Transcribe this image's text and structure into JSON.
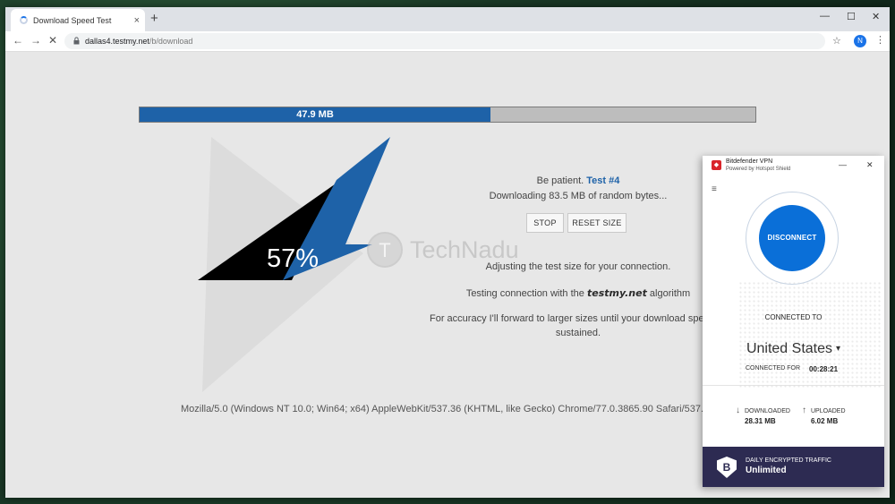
{
  "browser": {
    "tab_title": "Download Speed Test",
    "tab_close": "×",
    "new_tab": "+",
    "window_controls": [
      "—",
      "☐",
      "✕"
    ],
    "nav": {
      "back": "←",
      "forward": "→",
      "reload": "✕"
    },
    "url_host": "dallas4.testmy.net",
    "url_path": "/b/download",
    "profile_initial": "N",
    "menu": "⋮",
    "star": "☆"
  },
  "test": {
    "progress_label": "47.9 MB",
    "progress_fraction": 0.57,
    "percent": "57%",
    "patience_text": "Be patient.",
    "test_number": "Test #4",
    "downloading_text": "Downloading 83.5 MB of random bytes...",
    "stop_label": "STOP",
    "reset_label": "RESET SIZE",
    "adjusting_text": "Adjusting the test size for your connection.",
    "testing_prefix": "Testing connection with the",
    "brand": "testmy.net",
    "testing_suffix": "algorithm",
    "accuracy_line1": "For accuracy I'll forward to larger sizes until your download spe",
    "accuracy_line2": "sustained.",
    "user_agent": "Mozilla/5.0 (Windows NT 10.0; Win64; x64) AppleWebKit/537.36 (KHTML, like Gecko) Chrome/77.0.3865.90 Safari/537."
  },
  "watermark": {
    "glyph": "T",
    "text": "TechNadu"
  },
  "vpn": {
    "title": "Bitdefender VPN",
    "subtitle": "Powered by Hotspot Shield",
    "minimize": "—",
    "close": "✕",
    "menu_icon": "≡",
    "disconnect_label": "DISCONNECT",
    "connected_to_label": "CONNECTED TO",
    "country": "United States",
    "country_caret": "▾",
    "connected_for_label": "CONNECTED FOR",
    "duration": "00:28:21",
    "downloaded_label": "DOWNLOADED",
    "downloaded_value": "28.31 MB",
    "uploaded_label": "UPLOADED",
    "uploaded_value": "6.02 MB",
    "download_arrow": "↓",
    "upload_arrow": "↑",
    "footer_label": "DAILY ENCRYPTED TRAFFIC",
    "footer_value": "Unlimited",
    "footer_icon": "B"
  }
}
